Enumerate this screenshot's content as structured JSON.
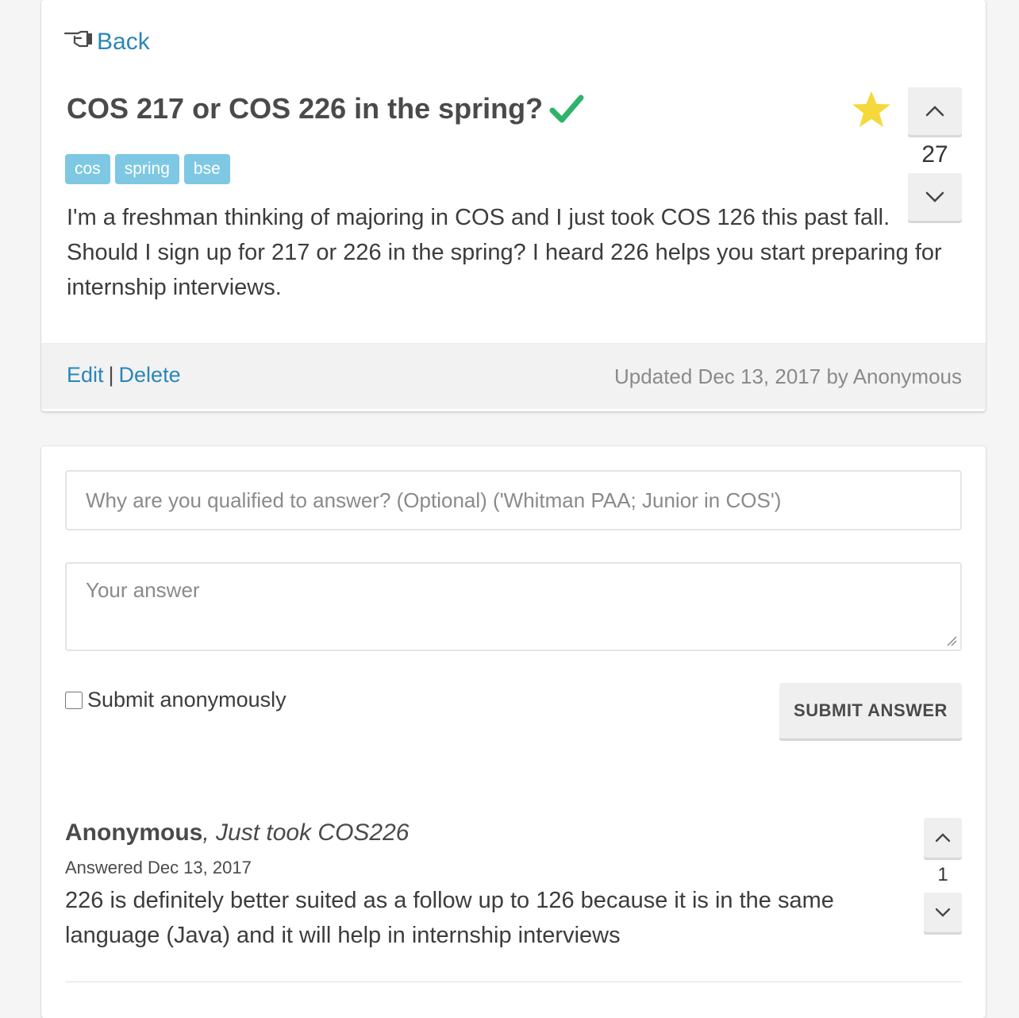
{
  "nav": {
    "back_label": "Back"
  },
  "question": {
    "title": "COS 217 or COS 226 in the spring?",
    "resolved": true,
    "starred": true,
    "vote_count": "27",
    "tags": [
      "cos",
      "spring",
      "bse"
    ],
    "body": "I'm a freshman thinking of majoring in COS and I just took COS 126 this past fall. Should I sign up for 217 or 226 in the spring? I heard 226 helps you start preparing for internship interviews.",
    "edit_label": "Edit",
    "separator": "|",
    "delete_label": "Delete",
    "updated_text": "Updated Dec 13, 2017 by Anonymous"
  },
  "answer_form": {
    "qualified_placeholder": "Why are you qualified to answer? (Optional) ('Whitman PAA; Junior in COS')",
    "answer_placeholder": "Your answer",
    "anonymous_label": "Submit anonymously",
    "anonymous_checked": false,
    "submit_label": "SUBMIT ANSWER"
  },
  "answers": [
    {
      "author": "Anonymous",
      "credential": ", Just took COS226",
      "date": "Answered Dec 13, 2017",
      "body": "226 is definitely better suited as a follow up to 126 because it is in the same language (Java) and it will help in internship interviews",
      "vote_count": "1"
    }
  ],
  "colors": {
    "link": "#2a86b8",
    "tag_bg": "#7ec8e3",
    "check": "#2fb36a",
    "star": "#f5d83a",
    "page_bg": "#f5f5f5"
  },
  "icons": {
    "back": "hand-pointing-left-icon",
    "resolved": "checkmark-icon",
    "favorite": "star-icon",
    "upvote": "chevron-up-icon",
    "downvote": "chevron-down-icon"
  }
}
